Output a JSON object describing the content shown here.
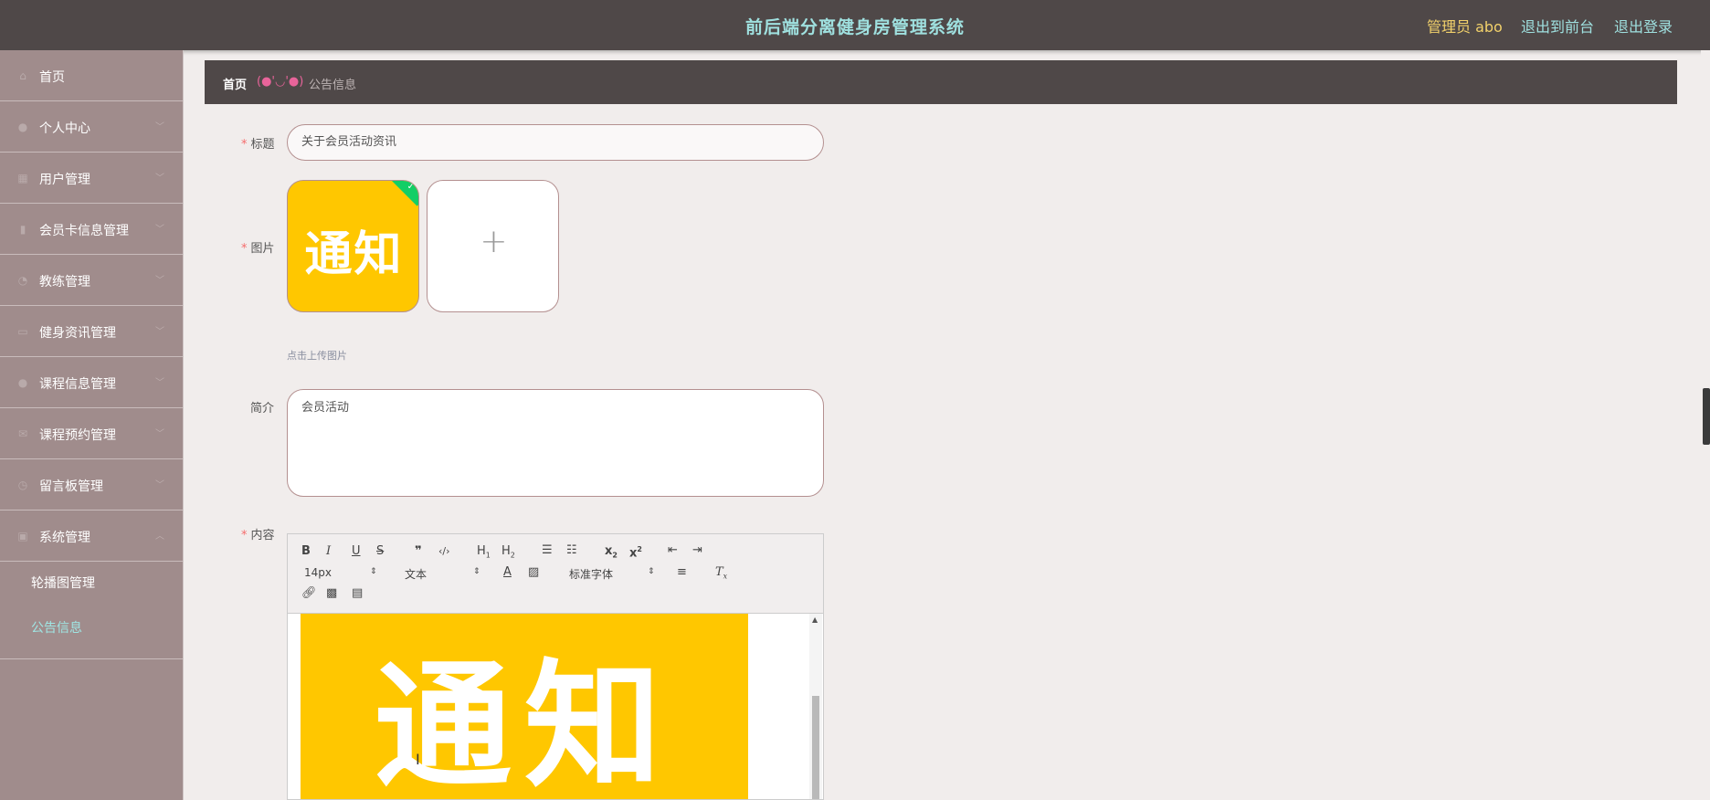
{
  "header": {
    "title": "前后端分离健身房管理系统",
    "user": "管理员 abo",
    "front_link": "退出到前台",
    "logout_link": "退出登录"
  },
  "sidebar": {
    "items": [
      {
        "label": "首页",
        "icon": "home-icon",
        "has_sub": false
      },
      {
        "label": "个人中心",
        "icon": "user-icon",
        "has_sub": true
      },
      {
        "label": "用户管理",
        "icon": "grid-icon",
        "has_sub": true
      },
      {
        "label": "会员卡信息管理",
        "icon": "card-icon",
        "has_sub": true
      },
      {
        "label": "教练管理",
        "icon": "coach-icon",
        "has_sub": true
      },
      {
        "label": "健身资讯管理",
        "icon": "news-icon",
        "has_sub": true
      },
      {
        "label": "课程信息管理",
        "icon": "course-icon",
        "has_sub": true
      },
      {
        "label": "课程预约管理",
        "icon": "booking-icon",
        "has_sub": true
      },
      {
        "label": "留言板管理",
        "icon": "message-icon",
        "has_sub": true
      },
      {
        "label": "系统管理",
        "icon": "settings-icon",
        "has_sub": true,
        "expanded": true
      }
    ],
    "sub_items": [
      {
        "label": "轮播图管理",
        "active": false
      },
      {
        "label": "公告信息",
        "active": true
      }
    ]
  },
  "breadcrumb": {
    "home": "首页",
    "separator": "(●'◡'●)",
    "current": "公告信息"
  },
  "form": {
    "title_label": "标题",
    "title_value": "关于会员活动资讯",
    "image_label": "图片",
    "image_thumb_text": "通知",
    "upload_tip": "点击上传图片",
    "intro_label": "简介",
    "intro_value": "会员活动",
    "content_label": "内容",
    "content_image_text": "通知"
  },
  "editor": {
    "font_size": "14px",
    "header_picker": "文本",
    "font_family": "标准字体",
    "buttons": [
      "bold",
      "italic",
      "underline",
      "strike",
      "blockquote",
      "code-block",
      "h1",
      "h2",
      "ordered-list",
      "bullet-list",
      "subscript",
      "superscript",
      "outdent",
      "indent",
      "color",
      "background",
      "align",
      "clean",
      "link",
      "image",
      "video"
    ]
  },
  "colors": {
    "topbar": "#4f4848",
    "sidebar": "#a08c8c",
    "accent": "#9fe0df",
    "user": "#f2d16b",
    "notice_yellow": "#ffc700"
  }
}
